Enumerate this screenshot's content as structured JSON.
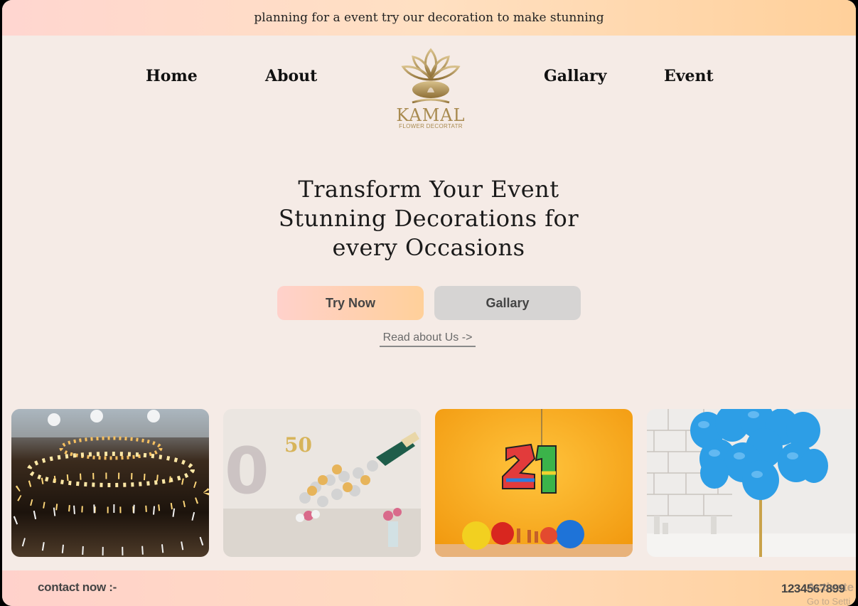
{
  "announcement": "planning for a event try our decoration to make stunning",
  "nav": {
    "home": "Home",
    "about": "About",
    "gallery": "Gallary",
    "event": "Event"
  },
  "logo": {
    "name": "KAMAL",
    "tagline": "FLOWER DECORTATR"
  },
  "hero": {
    "line1": "Transform Your Event",
    "line2": "Stunning Decorations for",
    "line3": "every Occasions"
  },
  "buttons": {
    "try_now": "Try Now",
    "gallery": "Gallary"
  },
  "read_link": "Read about Us ->",
  "footer": {
    "contact_label": "contact now :-",
    "phone": "1234567899",
    "activate_watermark": "Activate",
    "activate_sub": "Go to Setti"
  },
  "colors": {
    "page_bg": "#f5ebe6",
    "gold": "#a88a4f",
    "gradient_start": "#ffd6d0",
    "gradient_end": "#ffd09a"
  }
}
